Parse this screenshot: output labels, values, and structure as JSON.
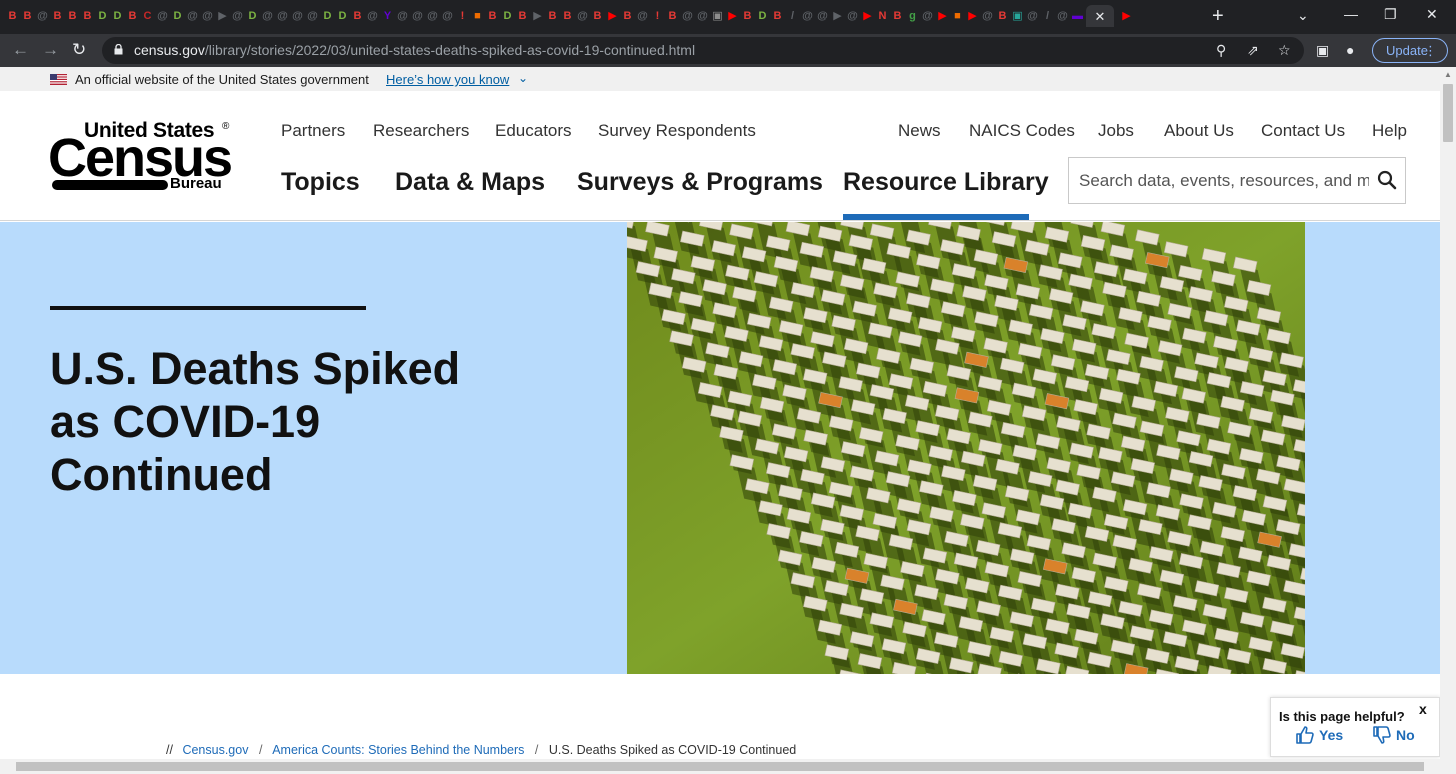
{
  "browser": {
    "tabs": [
      {
        "icon": "B",
        "color": "#e53935"
      },
      {
        "icon": "B",
        "color": "#e53935"
      },
      {
        "icon": "@",
        "color": "#5f6368"
      },
      {
        "icon": "B",
        "color": "#e53935"
      },
      {
        "icon": "B",
        "color": "#e53935"
      },
      {
        "icon": "B",
        "color": "#e53935"
      },
      {
        "icon": "D",
        "color": "#7cb342"
      },
      {
        "icon": "D",
        "color": "#7cb342"
      },
      {
        "icon": "B",
        "color": "#e53935"
      },
      {
        "icon": "C",
        "color": "#c62828"
      },
      {
        "icon": "@",
        "color": "#5f6368"
      },
      {
        "icon": "D",
        "color": "#7cb342"
      },
      {
        "icon": "@",
        "color": "#5f6368"
      },
      {
        "icon": "@",
        "color": "#5f6368"
      },
      {
        "icon": "▶",
        "color": "#5f6368"
      },
      {
        "icon": "@",
        "color": "#5f6368"
      },
      {
        "icon": "D",
        "color": "#7cb342"
      },
      {
        "icon": "@",
        "color": "#5f6368"
      },
      {
        "icon": "@",
        "color": "#5f6368"
      },
      {
        "icon": "@",
        "color": "#5f6368"
      },
      {
        "icon": "@",
        "color": "#5f6368"
      },
      {
        "icon": "D",
        "color": "#7cb342"
      },
      {
        "icon": "D",
        "color": "#7cb342"
      },
      {
        "icon": "B",
        "color": "#e53935"
      },
      {
        "icon": "@",
        "color": "#5f6368"
      },
      {
        "icon": "Y",
        "color": "#6001d2"
      },
      {
        "icon": "@",
        "color": "#5f6368"
      },
      {
        "icon": "@",
        "color": "#5f6368"
      },
      {
        "icon": "@",
        "color": "#5f6368"
      },
      {
        "icon": "@",
        "color": "#5f6368"
      },
      {
        "icon": "!",
        "color": "#e53935"
      },
      {
        "icon": "■",
        "color": "#ef6c00"
      },
      {
        "icon": "B",
        "color": "#e53935"
      },
      {
        "icon": "D",
        "color": "#7cb342"
      },
      {
        "icon": "B",
        "color": "#e53935"
      },
      {
        "icon": "▶",
        "color": "#5f6368"
      },
      {
        "icon": "B",
        "color": "#e53935"
      },
      {
        "icon": "B",
        "color": "#e53935"
      },
      {
        "icon": "@",
        "color": "#5f6368"
      },
      {
        "icon": "B",
        "color": "#e53935"
      },
      {
        "icon": "▶",
        "color": "#ff0000"
      },
      {
        "icon": "B",
        "color": "#e53935"
      },
      {
        "icon": "@",
        "color": "#5f6368"
      },
      {
        "icon": "!",
        "color": "#e53935"
      },
      {
        "icon": "B",
        "color": "#e53935"
      },
      {
        "icon": "@",
        "color": "#5f6368"
      },
      {
        "icon": "@",
        "color": "#5f6368"
      },
      {
        "icon": "▣",
        "color": "#8d8d8d"
      },
      {
        "icon": "▶",
        "color": "#ff0000"
      },
      {
        "icon": "B",
        "color": "#e53935"
      },
      {
        "icon": "D",
        "color": "#7cb342"
      },
      {
        "icon": "B",
        "color": "#e53935"
      },
      {
        "icon": "/",
        "color": "#5f6368"
      },
      {
        "icon": "@",
        "color": "#5f6368"
      },
      {
        "icon": "@",
        "color": "#5f6368"
      },
      {
        "icon": "▶",
        "color": "#5f6368"
      },
      {
        "icon": "@",
        "color": "#5f6368"
      },
      {
        "icon": "▶",
        "color": "#ff0000"
      },
      {
        "icon": "N",
        "color": "#e53935"
      },
      {
        "icon": "B",
        "color": "#e53935"
      },
      {
        "icon": "g",
        "color": "#43a047"
      },
      {
        "icon": "@",
        "color": "#5f6368"
      },
      {
        "icon": "▶",
        "color": "#ff0000"
      },
      {
        "icon": "■",
        "color": "#ef6c00"
      },
      {
        "icon": "▶",
        "color": "#ff0000"
      },
      {
        "icon": "@",
        "color": "#5f6368"
      },
      {
        "icon": "B",
        "color": "#e53935"
      },
      {
        "icon": "▣",
        "color": "#26a69a"
      },
      {
        "icon": "@",
        "color": "#5f6368"
      },
      {
        "icon": "/",
        "color": "#5f6368"
      },
      {
        "icon": "@",
        "color": "#5f6368"
      },
      {
        "icon": "▬",
        "color": "#6001d2"
      }
    ],
    "active_tab_close": "✕",
    "extra_tab": {
      "icon": "▶",
      "color": "#ff0000"
    },
    "new_tab": "+",
    "url_host": "census.gov",
    "url_path": "/library/stories/2022/03/united-states-deaths-spiked-as-covid-19-continued.html",
    "update_label": "Update",
    "menu_dots": "⋮"
  },
  "gov_banner": {
    "text": "An official website of the United States government",
    "link": "Here’s how you know",
    "chevron": "⌄"
  },
  "logo": {
    "line1": "United States",
    "reg": "®",
    "line2": "Census",
    "line3": "Bureau"
  },
  "utility_nav": [
    "Partners",
    "Researchers",
    "Educators",
    "Survey Respondents",
    "News",
    "NAICS Codes",
    "Jobs",
    "About Us",
    "Contact Us",
    "Help"
  ],
  "main_nav": [
    "Topics",
    "Data & Maps",
    "Surveys & Programs",
    "Resource Library"
  ],
  "search": {
    "placeholder": "Search data, events, resources, and more"
  },
  "hero": {
    "title": "U.S. Deaths Spiked as COVID-19 Continued"
  },
  "breadcrumb": {
    "prefix": "//",
    "items": [
      "Census.gov",
      "America Counts: Stories Behind the Numbers",
      "U.S. Deaths Spiked as COVID-19 Continued"
    ],
    "separator": "/"
  },
  "feedback": {
    "question": "Is this page helpful?",
    "close": "x",
    "yes": "Yes",
    "no": "No"
  },
  "colors": {
    "accent": "#1e6bb8",
    "hero_bg": "#b8dbfc",
    "gov_link": "#005ea2"
  }
}
